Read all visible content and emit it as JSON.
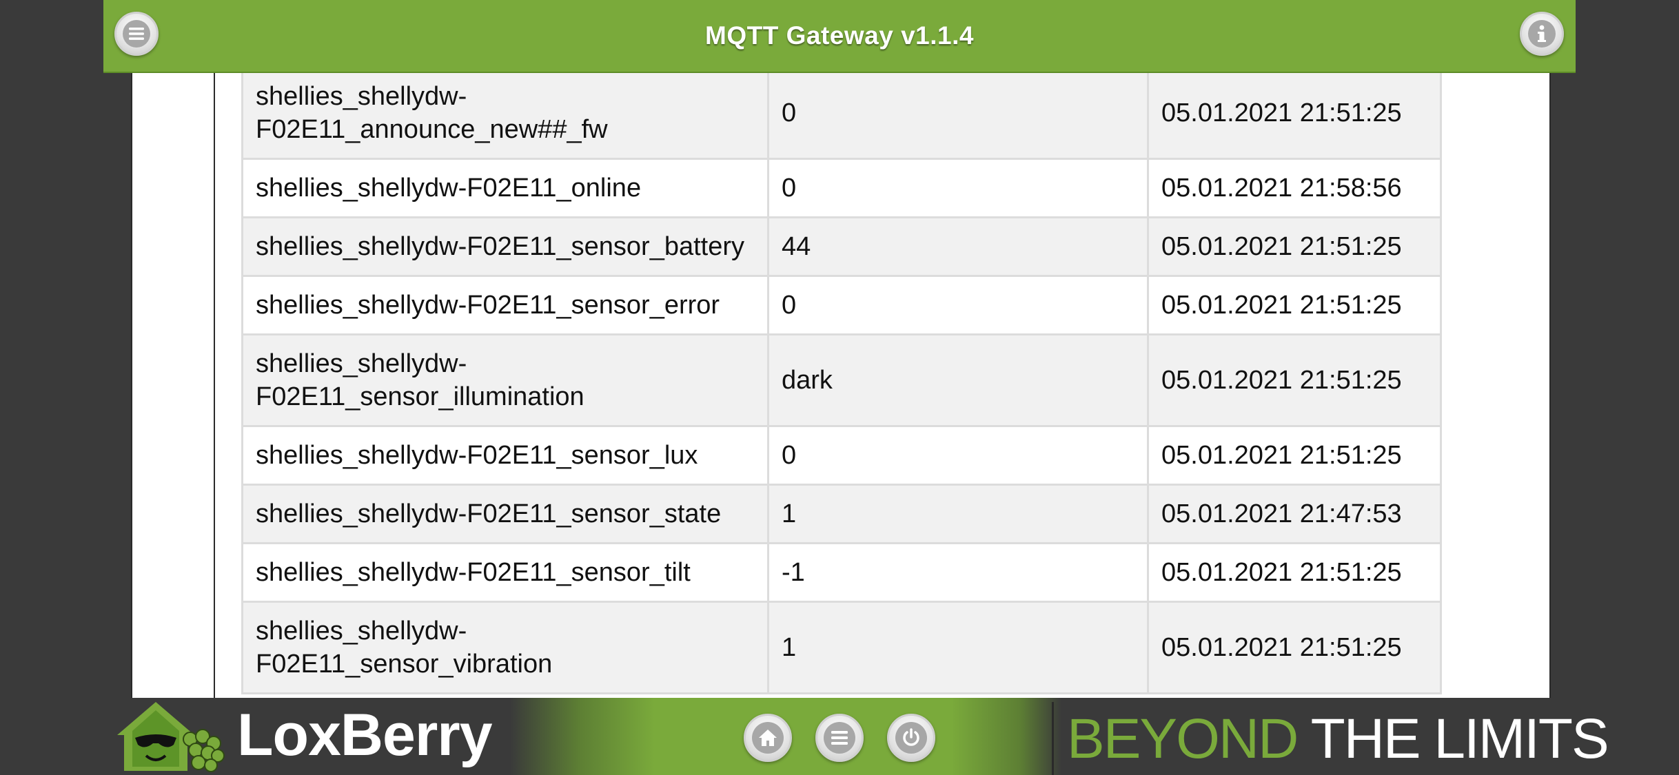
{
  "header": {
    "title": "MQTT Gateway v1.1.4",
    "menu_icon": "menu-icon",
    "info_icon": "info-icon"
  },
  "table": {
    "rows": [
      {
        "topic": "shellies_shellydw-F02E11_announce_new##_fw",
        "value": "0",
        "time": "05.01.2021 21:51:25"
      },
      {
        "topic": "shellies_shellydw-F02E11_online",
        "value": "0",
        "time": "05.01.2021 21:58:56"
      },
      {
        "topic": "shellies_shellydw-F02E11_sensor_battery",
        "value": "44",
        "time": "05.01.2021 21:51:25"
      },
      {
        "topic": "shellies_shellydw-F02E11_sensor_error",
        "value": "0",
        "time": "05.01.2021 21:51:25"
      },
      {
        "topic": "shellies_shellydw-F02E11_sensor_illumination",
        "value": "dark",
        "time": "05.01.2021 21:51:25"
      },
      {
        "topic": "shellies_shellydw-F02E11_sensor_lux",
        "value": "0",
        "time": "05.01.2021 21:51:25"
      },
      {
        "topic": "shellies_shellydw-F02E11_sensor_state",
        "value": "1",
        "time": "05.01.2021 21:47:53"
      },
      {
        "topic": "shellies_shellydw-F02E11_sensor_tilt",
        "value": "-1",
        "time": "05.01.2021 21:51:25"
      },
      {
        "topic": "shellies_shellydw-F02E11_sensor_vibration",
        "value": "1",
        "time": "05.01.2021 21:51:25"
      }
    ]
  },
  "footer": {
    "brand": "LoxBerry",
    "slogan_part1": "BEYOND",
    "slogan_part2": "THE LIMITS",
    "home_icon": "home-icon",
    "menu_icon": "menu-icon",
    "power_icon": "power-icon"
  },
  "colors": {
    "accent": "#7aaa3b",
    "background": "#3a3a3a"
  }
}
